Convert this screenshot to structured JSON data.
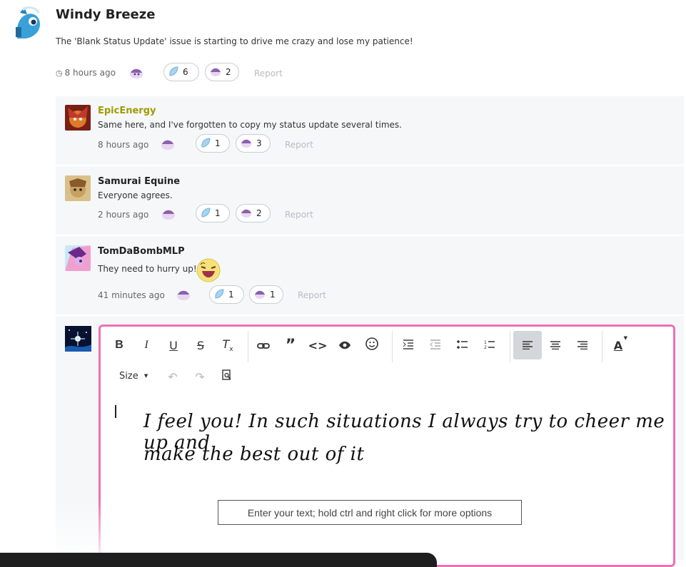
{
  "post": {
    "author": "Windy Breeze",
    "body": "The 'Blank Status Update' issue is starting to drive me crazy and lose my patience!",
    "time": "8 hours ago",
    "likes": "6",
    "hugs": "2",
    "report": "Report"
  },
  "comments": [
    {
      "author": "EpicEnergy",
      "author_color": "#a09a00",
      "body": "Same here, and I've forgotten to copy my status update several times.",
      "time": "8 hours ago",
      "likes": "1",
      "hugs": "3",
      "report": "Report"
    },
    {
      "author": "Samurai Equine",
      "author_color": "#222222",
      "body": "Everyone agrees.",
      "time": "2 hours ago",
      "likes": "1",
      "hugs": "2",
      "report": "Report"
    },
    {
      "author": "TomDaBombMLP",
      "author_color": "#222222",
      "body": "They need to hurry up!!!",
      "time": "41 minutes ago",
      "likes": "1",
      "hugs": "1",
      "report": "Report"
    }
  ],
  "editor": {
    "size_label": "Size",
    "line1": "I feel you! In such situations I always try to cheer me up and",
    "line2": "make the best out of it",
    "tooltip": "Enter your text; hold ctrl and right click for more options",
    "toolbar": [
      "bold-icon",
      "italic-icon",
      "underline-icon",
      "strikethrough-icon",
      "clear-format-icon",
      "link-icon",
      "quote-icon",
      "code-icon",
      "spoiler-eye-icon",
      "emoji-icon",
      "indent-icon",
      "outdent-icon",
      "bullet-list-icon",
      "numbered-list-icon",
      "align-left-icon",
      "align-center-icon",
      "align-right-icon",
      "text-color-icon",
      "undo-icon",
      "redo-icon",
      "preview-icon"
    ]
  },
  "colors": {
    "accent_border": "#f06fb5",
    "muted": "#b8bcc3"
  }
}
